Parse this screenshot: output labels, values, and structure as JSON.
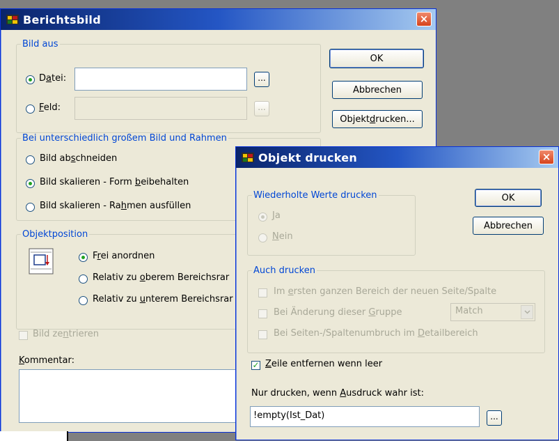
{
  "main_dialog": {
    "title": "Berichtsbild",
    "close": "×",
    "ok": "OK",
    "cancel": "Abbrechen",
    "print_object": {
      "pre": "Objekt ",
      "u": "d",
      "post": "rucken..."
    },
    "bild_aus": {
      "legend": "Bild aus",
      "datei": {
        "pre": "D",
        "u": "a",
        "post": "tei:"
      },
      "datei_value": "",
      "feld": {
        "pre": "",
        "u": "F",
        "post": "eld:"
      },
      "feld_value": "",
      "browse": "..."
    },
    "size_group": {
      "legend": "Bei unterschiedlich großem Bild und Rahmen",
      "opt1": {
        "pre": "Bild ab",
        "u": "s",
        "post": "chneiden"
      },
      "opt2": {
        "pre": "Bild skalieren - Form ",
        "u": "b",
        "post": "eibehalten"
      },
      "opt3": {
        "pre": "Bild skalieren - Ra",
        "u": "h",
        "post": "men ausfüllen"
      }
    },
    "position_group": {
      "legend": "Objektposition",
      "opt1": {
        "pre": "F",
        "u": "r",
        "post": "ei anordnen"
      },
      "opt2": {
        "pre": "Relativ zu ",
        "u": "o",
        "post": "berem Bereichsrar"
      },
      "opt3": {
        "pre": "Relativ zu ",
        "u": "u",
        "post": "nterem Bereichsrar"
      }
    },
    "center": {
      "pre": "Bild ze",
      "u": "n",
      "post": "trieren"
    },
    "comment_label": {
      "pre": "",
      "u": "K",
      "post": "ommentar:"
    },
    "comment_value": ""
  },
  "print_dialog": {
    "title": "Objekt drucken",
    "close": "×",
    "ok": "OK",
    "cancel": "Abbrechen",
    "repeat_group": {
      "legend": "Wiederholte Werte drucken",
      "ja": {
        "pre": "",
        "u": "J",
        "post": "a"
      },
      "nein": {
        "pre": "",
        "u": "N",
        "post": "ein"
      }
    },
    "also_group": {
      "legend": "Auch drucken",
      "opt1": {
        "pre": "Im ",
        "u": "e",
        "post": "rsten ganzen Bereich der neuen Seite/Spalte"
      },
      "opt2": {
        "pre": "Bei Änderung dieser ",
        "u": "G",
        "post": "ruppe"
      },
      "opt3": {
        "pre": "Bei Seiten-/Spaltenumbruch im ",
        "u": "D",
        "post": "etailbereich"
      },
      "group_select": "Match"
    },
    "remove_line": {
      "pre": "",
      "u": "Z",
      "post": "eile entfernen wenn leer"
    },
    "expr_label": {
      "pre": "Nur drucken, wenn ",
      "u": "A",
      "post": "usdruck wahr ist:"
    },
    "expr_value": "!empty(Ist_Dat)",
    "browse": "..."
  }
}
